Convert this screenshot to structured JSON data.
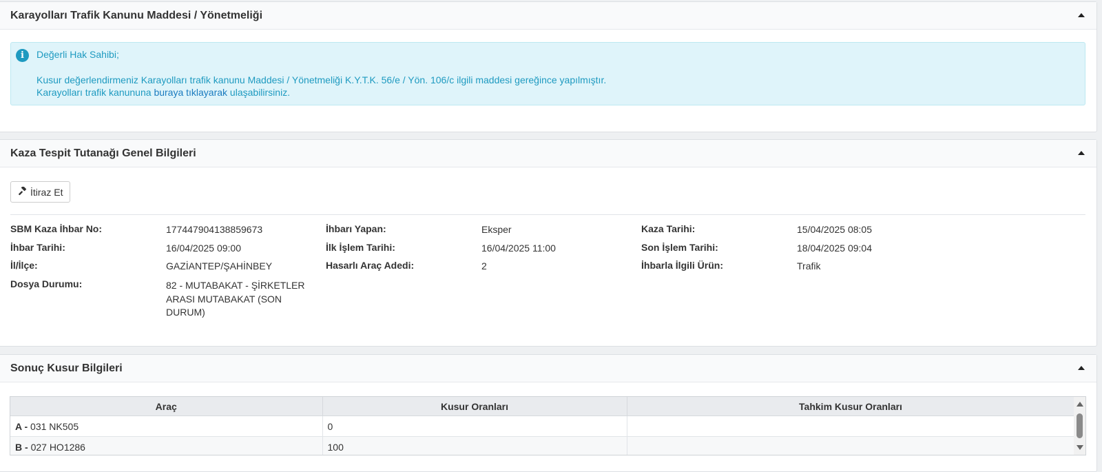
{
  "panel1": {
    "title": "Karayolları Trafik Kanunu Maddesi / Yönetmeliği",
    "alert": {
      "greeting": "Değerli Hak Sahibi;",
      "line1": "Kusur değerlendirmeniz Karayolları trafik kanunu Maddesi / Yönetmeliği K.Y.T.K. 56/e / Yön. 106/c ilgili maddesi gereğince yapılmıştır.",
      "line2_pre": "Karayolları trafik kanununa ",
      "line2_link": "buraya tıklayarak",
      "line2_post": " ulaşabilirsiniz."
    }
  },
  "panel2": {
    "title": "Kaza Tespit Tutanağı Genel Bilgileri",
    "objection_button": "İtiraz Et",
    "fields": {
      "sbm_no_label": "SBM Kaza İhbar No:",
      "sbm_no_value": "177447904138859673",
      "ihbar_yapan_label": "İhbarı Yapan:",
      "ihbar_yapan_value": "Eksper",
      "kaza_tarihi_label": "Kaza Tarihi:",
      "kaza_tarihi_value": "15/04/2025 08:05",
      "ihbar_tarihi_label": "İhbar Tarihi:",
      "ihbar_tarihi_value": "16/04/2025 09:00",
      "ilk_islem_label": "İlk İşlem Tarihi:",
      "ilk_islem_value": "16/04/2025 11:00",
      "son_islem_label": "Son İşlem Tarihi:",
      "son_islem_value": "18/04/2025 09:04",
      "il_ilce_label": "İl/İlçe:",
      "il_ilce_value": "GAZİANTEP/ŞAHİNBEY",
      "hasarli_arac_label": "Hasarlı Araç Adedi:",
      "hasarli_arac_value": "2",
      "urun_label": "İhbarla İlgili Ürün:",
      "urun_value": "Trafik",
      "dosya_durumu_label": "Dosya Durumu:",
      "dosya_durumu_value": "82 - MUTABAKAT - ŞİRKETLER ARASI MUTABAKAT (SON DURUM)"
    }
  },
  "panel3": {
    "title": "Sonuç Kusur Bilgileri",
    "columns": [
      "Araç",
      "Kusur Oranları",
      "Tahkim Kusur Oranları"
    ],
    "rows": [
      {
        "side": "A",
        "plate": "031 NK505",
        "kusur": "0",
        "tahkim": ""
      },
      {
        "side": "B",
        "plate": "027 HO1286",
        "kusur": "100",
        "tahkim": ""
      }
    ]
  }
}
